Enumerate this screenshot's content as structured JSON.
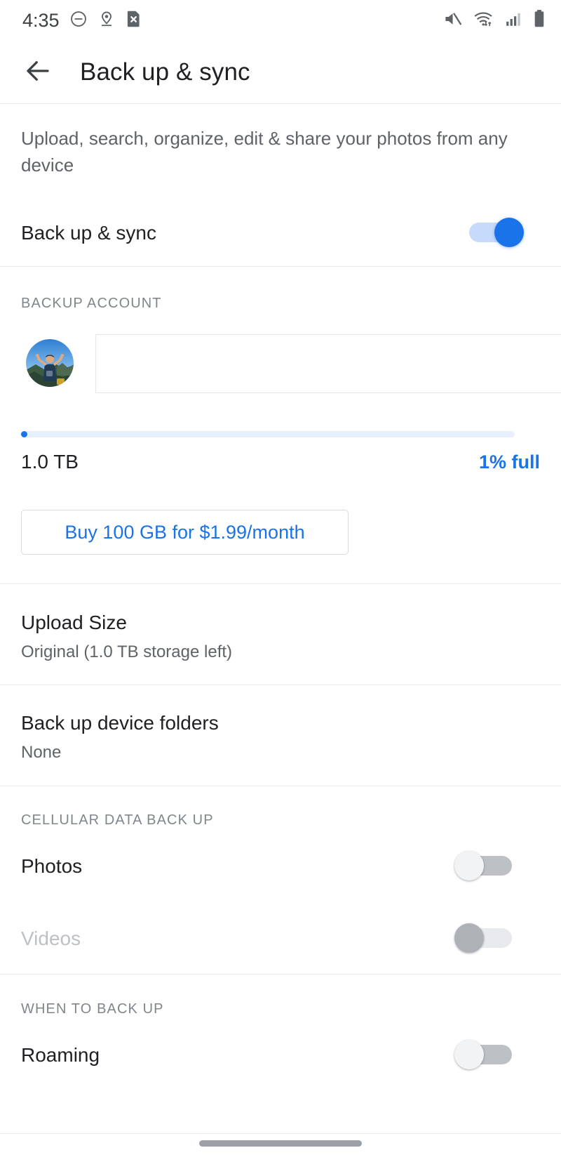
{
  "statusbar": {
    "time": "4:35",
    "left_icons": [
      "do-not-disturb-icon",
      "location-pin-icon",
      "sd-card-error-icon"
    ],
    "right_icons": [
      "volume-muted-icon",
      "wifi-data-icon",
      "cellular-signal-icon",
      "battery-full-icon"
    ]
  },
  "appbar": {
    "back_icon": "back-arrow-icon",
    "title": "Back up & sync"
  },
  "main": {
    "description": "Upload, search, organize, edit & share your photos from any device",
    "master_toggle": {
      "label": "Back up & sync",
      "state": "on"
    },
    "backup_account": {
      "section_label": "BACKUP ACCOUNT",
      "avatar": "user-avatar-photo",
      "account_name": ""
    },
    "storage": {
      "percent_used": 1,
      "total_label": "1.0 TB",
      "percent_label": "1% full",
      "buy_button_label": "Buy 100 GB for $1.99/month"
    },
    "upload_size": {
      "title": "Upload Size",
      "value": "Original (1.0 TB storage left)"
    },
    "device_folders": {
      "title": "Back up device folders",
      "value": "None"
    },
    "cellular": {
      "section_label": "CELLULAR DATA BACK UP",
      "items": [
        {
          "label": "Photos",
          "state": "off",
          "disabled": false
        },
        {
          "label": "Videos",
          "state": "off",
          "disabled": true
        }
      ]
    },
    "when_to_back_up": {
      "section_label": "WHEN TO BACK UP",
      "items": [
        {
          "label": "Roaming",
          "state": "off",
          "disabled": false
        }
      ]
    }
  },
  "colors": {
    "accent_blue": "#1a73e8",
    "track_on": "#c6dafc",
    "text_primary": "#202124",
    "text_secondary": "#5f6368",
    "text_muted": "#80868b",
    "divider": "#e8eaed"
  }
}
